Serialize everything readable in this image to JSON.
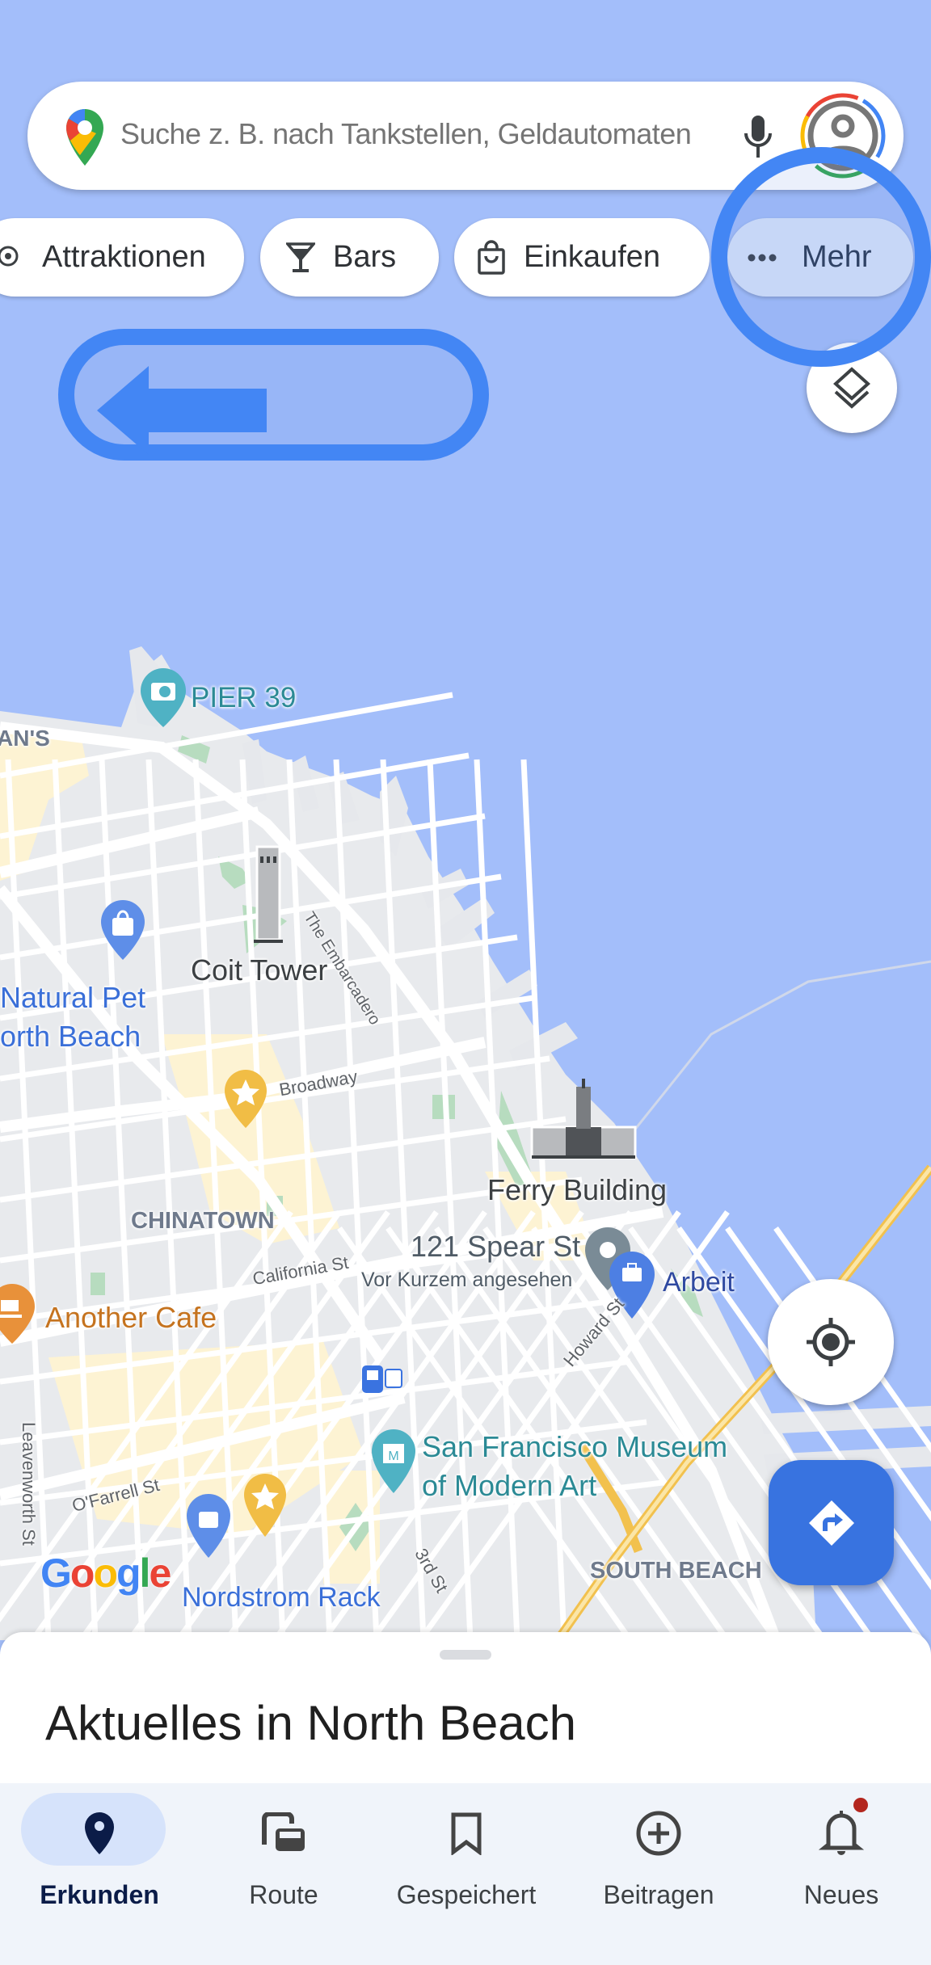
{
  "search": {
    "placeholder": "Suche z. B. nach Tankstellen, Geldautomaten",
    "logo_icon": "google-maps-pin-icon",
    "mic_icon": "microphone-icon",
    "avatar_icon": "account-avatar-icon"
  },
  "chips": [
    {
      "label": "Attraktionen",
      "icon": "ferris-wheel-icon"
    },
    {
      "label": "Bars",
      "icon": "cocktail-glass-icon"
    },
    {
      "label": "Einkaufen",
      "icon": "shopping-bag-icon"
    },
    {
      "label": "Mehr",
      "icon": "more-dots-icon",
      "highlighted": true
    }
  ],
  "overlay": {
    "back_arrow_icon": "left-arrow-icon",
    "highlight_circle_target": "Mehr"
  },
  "map": {
    "labels": {
      "pier39": "PIER 39",
      "fishermans": "AN'S",
      "coit": "Coit Tower",
      "embarcadero": "The Embarcadero",
      "natural_pet_1": "Natural Pet",
      "natural_pet_2": "orth Beach",
      "broadway": "Broadway",
      "chinatown": "CHINATOWN",
      "ferry": "Ferry Building",
      "spear": "121 Spear St",
      "spear_sub": "Vor Kurzem angesehen",
      "arbeit": "Arbeit",
      "california": "California St",
      "howard": "Howard St",
      "cafe": "Another Cafe",
      "sfmoma_1": "San Francisco Museum",
      "sfmoma_2": "of Modern Art",
      "leavenworth": "Leavenworth St",
      "ofarrell": "O'Farrell St",
      "third": "3rd St",
      "south_beach": "SOUTH BEACH",
      "nordstrom": "Nordstrom Rack",
      "google": "Google"
    },
    "colors": {
      "water": "#a3befa",
      "land": "#e8eaed",
      "park": "#b7dcbf",
      "highway": "#f6c954",
      "poi_teal": "#4fb2c4",
      "poi_blue": "#5e8ee8",
      "poi_yellow": "#f1bd45",
      "poi_orange": "#e8913a"
    }
  },
  "controls": {
    "layers_icon": "layers-icon",
    "location_icon": "my-location-icon",
    "directions_icon": "directions-icon"
  },
  "sheet": {
    "title": "Aktuelles in North Beach"
  },
  "nav": {
    "items": [
      {
        "label": "Erkunden",
        "icon": "explore-pin-icon",
        "active": true
      },
      {
        "label": "Route",
        "icon": "commute-icon"
      },
      {
        "label": "Gespeichert",
        "icon": "bookmark-icon"
      },
      {
        "label": "Beitragen",
        "icon": "add-circle-icon"
      },
      {
        "label": "Neues",
        "icon": "notifications-bell-icon",
        "badge": true
      }
    ]
  },
  "accent": "#4285f4"
}
